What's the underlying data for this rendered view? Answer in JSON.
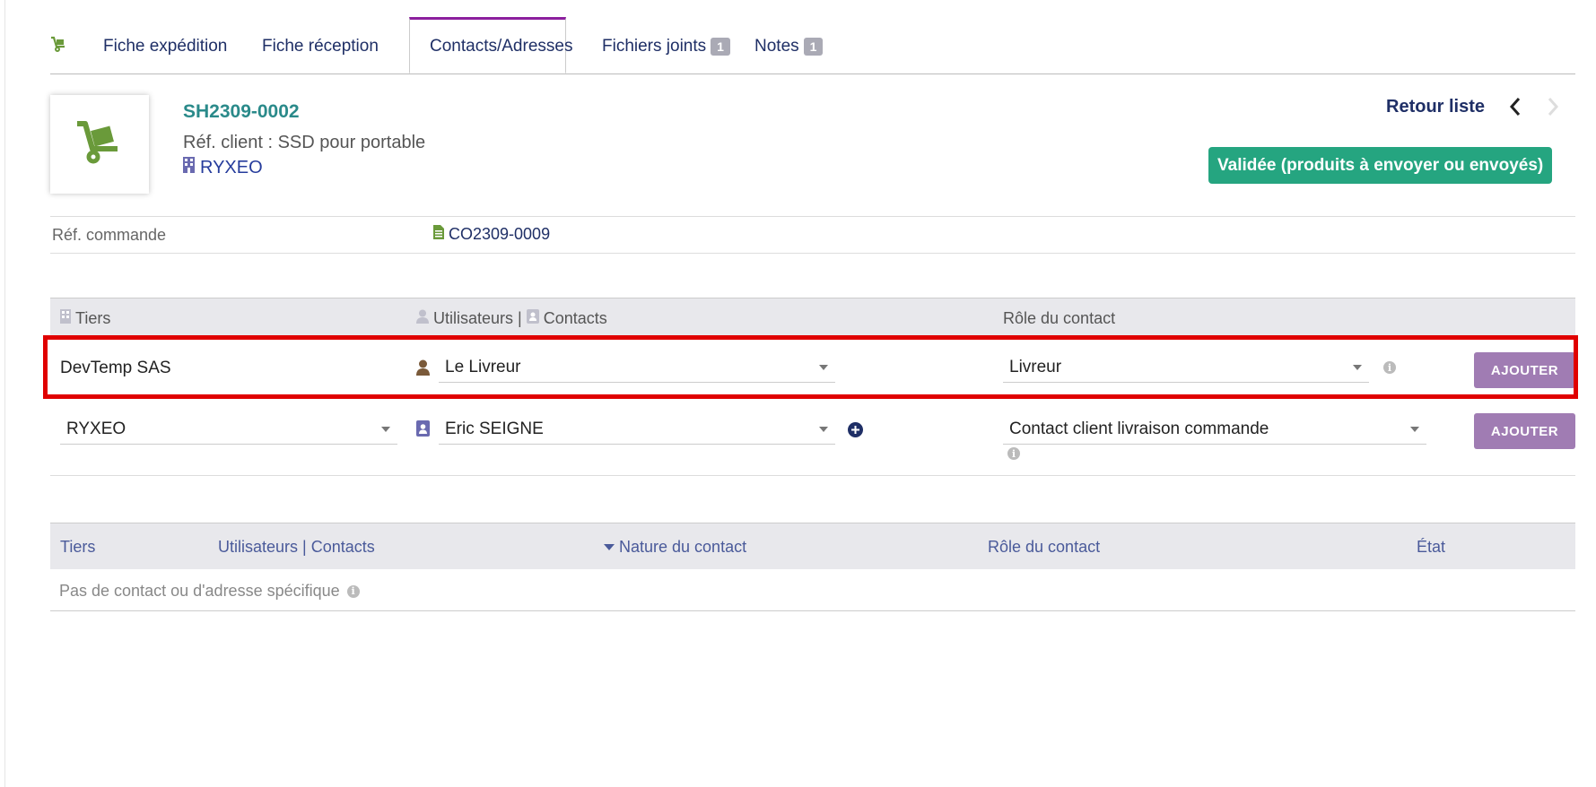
{
  "tabs": [
    {
      "label": "Fiche expédition"
    },
    {
      "label": "Fiche réception"
    },
    {
      "label": "Contacts/Adresses",
      "active": true
    },
    {
      "label": "Fichiers joints",
      "badge": "1"
    },
    {
      "label": "Notes",
      "badge": "1"
    }
  ],
  "header": {
    "ref": "SH2309-0002",
    "ref_client": "Réf. client : SSD pour portable",
    "thirdparty": "RYXEO",
    "retour_liste": "Retour liste",
    "status": "Validée (produits à envoyer ou envoyés)"
  },
  "order": {
    "label": "Réf. commande",
    "value": "CO2309-0009"
  },
  "add_contact": {
    "headers": {
      "tiers": "Tiers",
      "users": "Utilisateurs",
      "separator": "|",
      "contacts": "Contacts",
      "role": "Rôle du contact"
    },
    "row_internal": {
      "tiers": "DevTemp SAS",
      "user": "Le Livreur",
      "role": "Livreur",
      "button": "AJOUTER"
    },
    "row_external": {
      "tiers": "RYXEO",
      "contact": "Eric SEIGNE",
      "role": "Contact client livraison commande",
      "button": "AJOUTER"
    }
  },
  "list": {
    "headers": {
      "tiers": "Tiers",
      "users_contacts": "Utilisateurs | Contacts",
      "nature": "Nature du contact",
      "role": "Rôle du contact",
      "state": "État"
    },
    "empty": "Pas de contact ou d'adresse spécifique"
  },
  "colors": {
    "accent_purple": "#8c1f9e",
    "status_green": "#25a580",
    "button_purple": "#a07cb3",
    "highlight_red": "#e00000",
    "icon_green": "#6a9a3a"
  }
}
